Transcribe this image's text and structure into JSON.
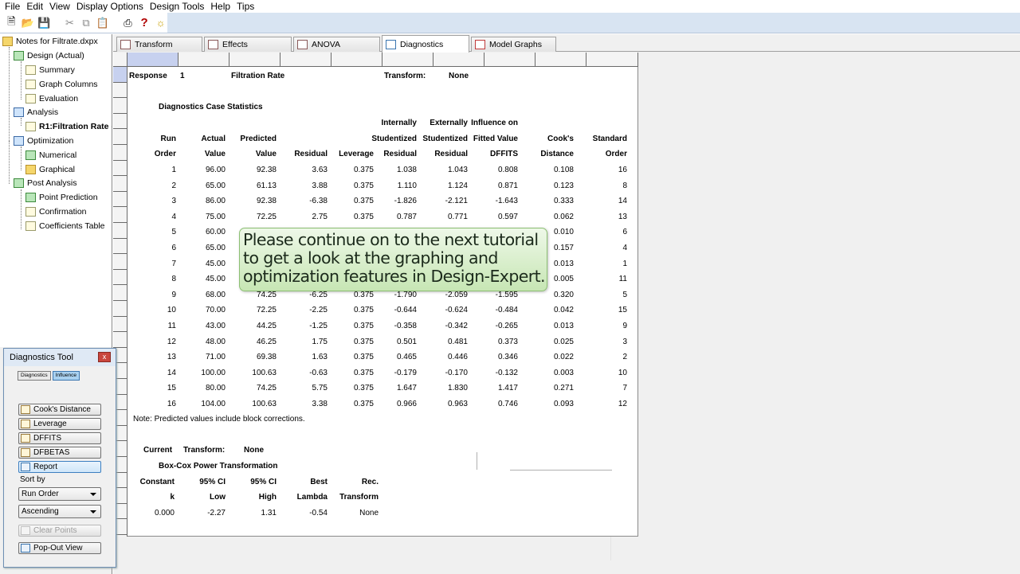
{
  "menu": [
    "File",
    "Edit",
    "View",
    "Display Options",
    "Design Tools",
    "Help",
    "Tips"
  ],
  "toolbar": {
    "icons": [
      "new-file-icon",
      "open-folder-icon",
      "save-icon",
      "cut-icon",
      "copy-icon",
      "paste-icon",
      "print-icon",
      "help-icon",
      "tip-lightbulb-icon"
    ]
  },
  "tree": {
    "root": "Notes for Filtrate.dxpx",
    "items": [
      {
        "label": "Design (Actual)"
      },
      {
        "label": "Summary"
      },
      {
        "label": "Graph Columns"
      },
      {
        "label": "Evaluation"
      },
      {
        "label": "Analysis"
      },
      {
        "label": "R1:Filtration Rate ("
      },
      {
        "label": "Optimization"
      },
      {
        "label": "Numerical"
      },
      {
        "label": "Graphical"
      },
      {
        "label": "Post Analysis"
      },
      {
        "label": "Point Prediction"
      },
      {
        "label": "Confirmation"
      },
      {
        "label": "Coefficients Table"
      }
    ]
  },
  "diagnostics_tool": {
    "title": "Diagnostics Tool",
    "close": "x",
    "tabs": [
      "Diagnostics",
      "Influence"
    ],
    "active_tab": "Influence",
    "buttons": [
      "Cook's Distance",
      "Leverage",
      "DFFITS",
      "DFBETAS",
      "Report"
    ],
    "selected_button": "Report",
    "sort_by_label": "Sort by",
    "sort_field": "Run Order",
    "sort_direction": "Ascending",
    "clear_points": "Clear Points",
    "pop_out": "Pop-Out View"
  },
  "tabs": [
    "Transform",
    "Effects",
    "ANOVA",
    "Diagnostics",
    "Model Graphs"
  ],
  "active_tab": "Diagnostics",
  "report": {
    "response_label": "Response",
    "response_num": "1",
    "response_name": "Filtration Rate",
    "transform_label": "Transform:",
    "transform_value": "None",
    "section_title": "Diagnostics Case Statistics",
    "headers": {
      "row1": [
        "",
        "",
        "",
        "",
        "",
        "Internally",
        "Externally",
        "Influence on",
        "",
        ""
      ],
      "row2": [
        "Run",
        "Actual",
        "Predicted",
        "",
        "",
        "Studentized",
        "Studentized",
        "Fitted Value",
        "Cook's",
        "Standard"
      ],
      "row3": [
        "Order",
        "Value",
        "Value",
        "Residual",
        "Leverage",
        "Residual",
        "Residual",
        "DFFITS",
        "Distance",
        "Order"
      ]
    },
    "rows": [
      [
        "1",
        "96.00",
        "92.38",
        "3.63",
        "0.375",
        "1.038",
        "1.043",
        "0.808",
        "0.108",
        "16"
      ],
      [
        "2",
        "65.00",
        "61.13",
        "3.88",
        "0.375",
        "1.110",
        "1.124",
        "0.871",
        "0.123",
        "8"
      ],
      [
        "3",
        "86.00",
        "92.38",
        "-6.38",
        "0.375",
        "-1.826",
        "-2.121",
        "-1.643",
        "0.333",
        "14"
      ],
      [
        "4",
        "75.00",
        "72.25",
        "2.75",
        "0.375",
        "0.787",
        "0.771",
        "0.597",
        "0.062",
        "13"
      ],
      [
        "5",
        "60.00",
        "",
        "",
        "",
        "",
        "",
        "",
        "0.010",
        "6"
      ],
      [
        "6",
        "65.00",
        "",
        "",
        "",
        "",
        "",
        "",
        "0.157",
        "4"
      ],
      [
        "7",
        "45.00",
        "",
        "",
        "",
        "",
        "",
        "",
        "0.013",
        "1"
      ],
      [
        "8",
        "45.00",
        "",
        "",
        "",
        "",
        "",
        "",
        "0.005",
        "11"
      ],
      [
        "9",
        "68.00",
        "74.25",
        "-6.25",
        "0.375",
        "-1.790",
        "-2.059",
        "-1.595",
        "0.320",
        "5"
      ],
      [
        "10",
        "70.00",
        "72.25",
        "-2.25",
        "0.375",
        "-0.644",
        "-0.624",
        "-0.484",
        "0.042",
        "15"
      ],
      [
        "11",
        "43.00",
        "44.25",
        "-1.25",
        "0.375",
        "-0.358",
        "-0.342",
        "-0.265",
        "0.013",
        "9"
      ],
      [
        "12",
        "48.00",
        "46.25",
        "1.75",
        "0.375",
        "0.501",
        "0.481",
        "0.373",
        "0.025",
        "3"
      ],
      [
        "13",
        "71.00",
        "69.38",
        "1.63",
        "0.375",
        "0.465",
        "0.446",
        "0.346",
        "0.022",
        "2"
      ],
      [
        "14",
        "100.00",
        "100.63",
        "-0.63",
        "0.375",
        "-0.179",
        "-0.170",
        "-0.132",
        "0.003",
        "10"
      ],
      [
        "15",
        "80.00",
        "74.25",
        "5.75",
        "0.375",
        "1.647",
        "1.830",
        "1.417",
        "0.271",
        "7"
      ],
      [
        "16",
        "104.00",
        "100.63",
        "3.38",
        "0.375",
        "0.966",
        "0.963",
        "0.746",
        "0.093",
        "12"
      ]
    ],
    "note": "Note: Predicted values include block corrections.",
    "current_label": "Current",
    "current_transform_label": "Transform:",
    "current_transform_value": "None",
    "boxcox_title": "Box-Cox Power Transformation",
    "boxcox_headers": {
      "row1": [
        "Constant",
        "95% CI",
        "95% CI",
        "Best",
        "Rec."
      ],
      "row2": [
        "k",
        "Low",
        "High",
        "Lambda",
        "Transform"
      ]
    },
    "boxcox_values": [
      "0.000",
      "-2.27",
      "1.31",
      "-0.54",
      "None"
    ]
  },
  "callout": {
    "lines": [
      "Please continue on to the next tutorial",
      "to get a look at the graphing and",
      "optimization features in Design-Expert."
    ]
  }
}
